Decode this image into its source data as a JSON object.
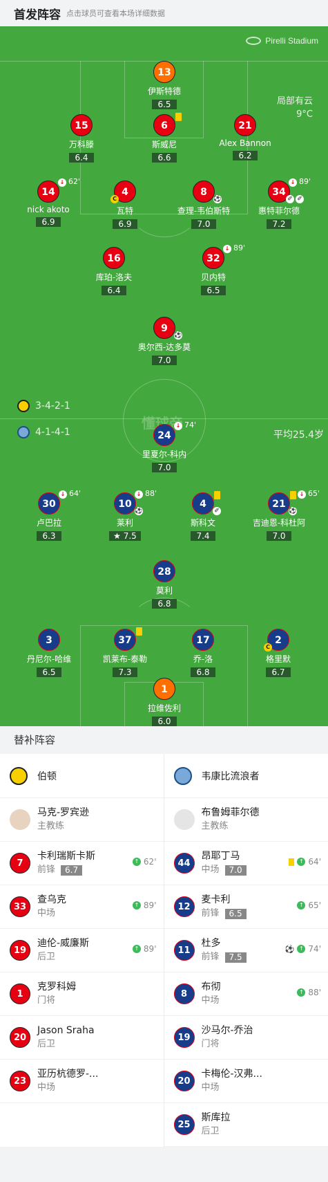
{
  "header": {
    "title": "首发阵容",
    "hint": "点击球员可查看本场详细数据"
  },
  "venue": {
    "stadium": "Pirelli Stadium",
    "weather": "局部有云",
    "temperature": "9°C"
  },
  "watermark": "懂球帝",
  "home": {
    "formation": "3-4-2-1"
  },
  "away": {
    "formation": "4-1-4-1",
    "avg_age": "平均25.4岁"
  },
  "home_players": [
    {
      "num": "13",
      "name": "伊斯特德",
      "rating": "6.5"
    },
    {
      "num": "15",
      "name": "万科滕",
      "rating": "6.4"
    },
    {
      "num": "6",
      "name": "斯威尼",
      "rating": "6.6"
    },
    {
      "num": "21",
      "name": "Alex Bannon",
      "rating": "6.2"
    },
    {
      "num": "14",
      "name": "nick akoto",
      "rating": "6.9",
      "sub_min": "62'"
    },
    {
      "num": "4",
      "name": "瓦特",
      "rating": "6.9"
    },
    {
      "num": "8",
      "name": "查理-韦伯斯特",
      "rating": "7.0"
    },
    {
      "num": "34",
      "name": "惠特菲尔德",
      "rating": "7.2",
      "sub_min": "89'"
    },
    {
      "num": "16",
      "name": "库珀-洛夫",
      "rating": "6.4"
    },
    {
      "num": "32",
      "name": "贝内特",
      "rating": "6.5",
      "sub_min": "89'"
    },
    {
      "num": "9",
      "name": "奥尔西-达多莫",
      "rating": "7.0"
    }
  ],
  "away_players": [
    {
      "num": "24",
      "name": "里夏尔-科内",
      "rating": "7.0",
      "sub_min": "74'"
    },
    {
      "num": "30",
      "name": "卢巴拉",
      "rating": "6.3",
      "sub_min": "64'"
    },
    {
      "num": "10",
      "name": "莱利",
      "rating": "7.5",
      "sub_min": "88'"
    },
    {
      "num": "4",
      "name": "斯科文",
      "rating": "7.4"
    },
    {
      "num": "21",
      "name": "吉迪恩-科杜阿",
      "rating": "7.0",
      "sub_min": "65'"
    },
    {
      "num": "28",
      "name": "莫利",
      "rating": "6.8"
    },
    {
      "num": "3",
      "name": "丹尼尔-哈维",
      "rating": "6.5"
    },
    {
      "num": "37",
      "name": "凯莱布-泰勒",
      "rating": "7.3"
    },
    {
      "num": "17",
      "name": "乔-洛",
      "rating": "6.8"
    },
    {
      "num": "2",
      "name": "格里默",
      "rating": "6.7"
    },
    {
      "num": "1",
      "name": "拉维佐利",
      "rating": "6.0"
    }
  ],
  "subs_title": "替补阵容",
  "home_subs": {
    "team": "伯顿",
    "coach": {
      "name": "马克-罗宾逊",
      "role": "主教练"
    },
    "players": [
      {
        "num": "7",
        "name": "卡利瑞斯卡斯",
        "pos": "前锋",
        "rating": "6.7",
        "event_min": "62'"
      },
      {
        "num": "33",
        "name": "查乌克",
        "pos": "中场",
        "event_min": "89'"
      },
      {
        "num": "19",
        "name": "迪伦-威廉斯",
        "pos": "后卫",
        "event_min": "89'"
      },
      {
        "num": "1",
        "name": "克罗科姆",
        "pos": "门将"
      },
      {
        "num": "20",
        "name": "Jason Sraha",
        "pos": "后卫"
      },
      {
        "num": "23",
        "name": "亚历杭德罗-...",
        "pos": "中场"
      }
    ]
  },
  "away_subs": {
    "team": "韦康比流浪者",
    "coach": {
      "name": "布鲁姆菲尔德",
      "role": "主教练"
    },
    "players": [
      {
        "num": "44",
        "name": "昂耶丁马",
        "pos": "中场",
        "rating": "7.0",
        "event_min": "64'"
      },
      {
        "num": "12",
        "name": "麦卡利",
        "pos": "前锋",
        "rating": "6.5",
        "event_min": "65'"
      },
      {
        "num": "11",
        "name": "杜多",
        "pos": "前锋",
        "rating": "7.5",
        "event_min": "74'"
      },
      {
        "num": "8",
        "name": "布彻",
        "pos": "中场",
        "event_min": "88'"
      },
      {
        "num": "19",
        "name": "沙马尔-乔治",
        "pos": "门将"
      },
      {
        "num": "20",
        "name": "卡梅伦-汉弗...",
        "pos": "中场"
      },
      {
        "num": "25",
        "name": "斯库拉",
        "pos": "后卫"
      }
    ]
  },
  "colors": {
    "pitch": "#43a83d",
    "home": "#e60012",
    "away": "#173d8a",
    "gk": "#ff6f00",
    "rating_bg": "#27592a",
    "yellow": "#f8d000"
  }
}
